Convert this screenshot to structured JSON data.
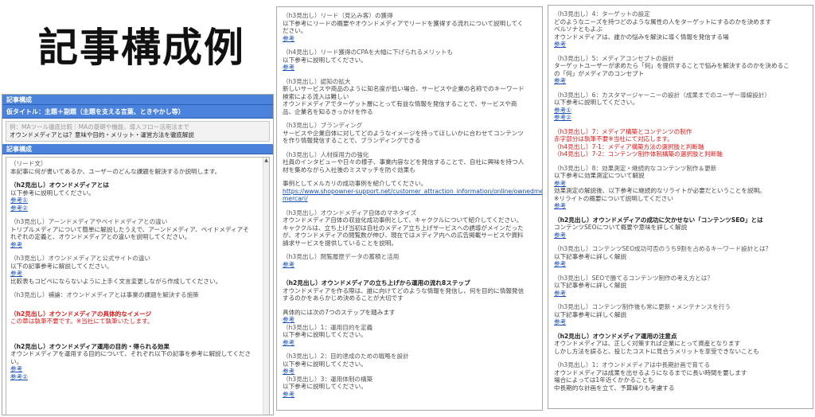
{
  "page_title": "記事構成例",
  "left": {
    "section1_bar": "記事構成",
    "title_bar": "仮タイトル：主題＋副題（主題を支える言葉、ときやかし等）",
    "title_field_placeholder": "例：MAツール徹底比較｜MAの基礎や機能、導入フロー活用法まで",
    "title_field_value": "オウンドメディアとは？意味や目的・メリット・運営方法を徹底解説",
    "section2_bar": "記事構成",
    "lines": [
      {
        "t": "（リード文）",
        "c": "h"
      },
      {
        "t": "本記事に何が書いてあるか、ユーザーのどんな課題を解決するか説明します。",
        "c": "n"
      },
      {
        "t": "",
        "c": "gap"
      },
      {
        "t": "（h2見出し）オウンドメディアとは",
        "c": "b"
      },
      {
        "t": "以下参考に説明してください。",
        "c": "n"
      },
      {
        "t": "参考①",
        "c": "link"
      },
      {
        "t": "参考②",
        "c": "link"
      },
      {
        "t": "",
        "c": "gap"
      },
      {
        "t": "（h3見出し）アーンドメディアやペイドメディアとの違い",
        "c": "h"
      },
      {
        "t": "トリプルメディアについて簡単に解説したうえで、アーンドメディア、ペイドメディアそ",
        "c": "n"
      },
      {
        "t": "れぞれの定義と、オウンドメディアとの違いを説明してください。",
        "c": "n"
      },
      {
        "t": "参考",
        "c": "link"
      },
      {
        "t": "",
        "c": "gap"
      },
      {
        "t": "（h3見出し）オウンドメディアと公式サイトの違い",
        "c": "h"
      },
      {
        "t": "以下の記事参考に解説してください。",
        "c": "n"
      },
      {
        "t": "参考",
        "c": "link"
      },
      {
        "t": "比較表もコピペにならないように上手く文言変更しながら作成してください。",
        "c": "n"
      },
      {
        "t": "",
        "c": "gap"
      },
      {
        "t": "（h3見出し）補論：オウンドメディアとは事業の課題を解決する施策",
        "c": "h"
      },
      {
        "t": "",
        "c": "gap2"
      },
      {
        "t": "（h2見出し）オウンドメディアの具体的なイメージ",
        "c": "redb"
      },
      {
        "t": "この章は執筆不要です。※当社にて執筆いたします。",
        "c": "red"
      },
      {
        "t": "",
        "c": "gap2"
      },
      {
        "t": "",
        "c": "gap"
      },
      {
        "t": "（h2見出し）オウンドメディア運用の目的・得られる効果",
        "c": "b"
      },
      {
        "t": "オウンドメディアを運用する目的について、それぞれ以下の記事を参考に解説してくださ",
        "c": "n"
      },
      {
        "t": "い。",
        "c": "n"
      },
      {
        "t": "参考",
        "c": "link"
      },
      {
        "t": "参考②",
        "c": "link"
      }
    ]
  },
  "middle": {
    "lines": [
      {
        "t": "（h3見出し）リード（見込み客）の獲得",
        "c": "h"
      },
      {
        "t": "以下参考にリードの概要やオウンドメディアでリードを獲得する流れについて説明してく",
        "c": "n"
      },
      {
        "t": "ださい。",
        "c": "n"
      },
      {
        "t": "参考",
        "c": "link"
      },
      {
        "t": "",
        "c": "gap"
      },
      {
        "t": "（h4見出し）リード獲得のCPAを大幅に下げられるメリットも",
        "c": "h"
      },
      {
        "t": "以下参考に説明してください。",
        "c": "n"
      },
      {
        "t": "参考",
        "c": "link"
      },
      {
        "t": "",
        "c": "gap"
      },
      {
        "t": "（h3見出し）認知の拡大",
        "c": "h"
      },
      {
        "t": "新しいサービスや商品のように知名度が低い場合、サービスや企業の名称でのキーワード",
        "c": "n"
      },
      {
        "t": "検索による流入は難しい",
        "c": "n"
      },
      {
        "t": "オウンドメディアでターゲット層にとって有益な情報を発信することで、サービスや商",
        "c": "n"
      },
      {
        "t": "品、企業名を知るきっかけを作る",
        "c": "n"
      },
      {
        "t": "",
        "c": "gap"
      },
      {
        "t": "（h3見出し）ブランディング",
        "c": "h"
      },
      {
        "t": "サービスや企業自体に対してどのようなイメージを持ってほしいかに合わせてコンテンツ",
        "c": "n"
      },
      {
        "t": "を作り情報発信することで、ブランディングできる",
        "c": "n"
      },
      {
        "t": "",
        "c": "gap"
      },
      {
        "t": "（h3見出し）人材採用力の強化",
        "c": "h"
      },
      {
        "t": "社員のインタビューや日々の様子、事業内容などを発信することで、自社に興味を持つ人",
        "c": "n"
      },
      {
        "t": "材を集めながら入社後のミスマッチを防ぐ効果も",
        "c": "n"
      },
      {
        "t": "",
        "c": "gap"
      },
      {
        "t": "事例としてメルカリの成功事例を紹介してください。",
        "c": "n"
      },
      {
        "t": "https://www.shopowner-support.net/customer_attraction_information/online/ownedmedia/",
        "c": "link"
      },
      {
        "t": "mercari/",
        "c": "link"
      },
      {
        "t": "",
        "c": "gap"
      },
      {
        "t": "（h3見出し）オウンドメディア自体のマネタイズ",
        "c": "h"
      },
      {
        "t": "オウンドメディア自体の収益化成功事例として、キャククルについて紹介してください。",
        "c": "n"
      },
      {
        "t": "キャククルは、立ち上げ当初は自社のメディア立ち上げサービスへの誘導がメインだった",
        "c": "n"
      },
      {
        "t": "が、オウンドメディアの閲覧数が伸び、現在ではメディア内への広告掲載サービスや資料",
        "c": "n"
      },
      {
        "t": "請求サービスを提供していることを説明。",
        "c": "n"
      },
      {
        "t": "",
        "c": "gap"
      },
      {
        "t": "（h3見出し）閲覧履歴データの蓄積と活用",
        "c": "h"
      },
      {
        "t": "参考",
        "c": "link"
      },
      {
        "t": "",
        "c": "gap2"
      },
      {
        "t": "（h2見出し）オウンドメディアの立ち上げから運用の流れ8ステップ",
        "c": "b"
      },
      {
        "t": "オウンドメディアを作る際は、誰に向けてどのような情報を発信し、何を目的に情報発信",
        "c": "n"
      },
      {
        "t": "するのかをあらかじめ決めることが大切です",
        "c": "n"
      },
      {
        "t": "",
        "c": "gap"
      },
      {
        "t": "具体的には次の7つのステップを踏みます",
        "c": "n"
      },
      {
        "t": "参考",
        "c": "link"
      },
      {
        "t": "（h3見出し）1：運用目的を定義",
        "c": "h"
      },
      {
        "t": "以下参考に説明してください。",
        "c": "n"
      },
      {
        "t": "参考",
        "c": "link"
      },
      {
        "t": "",
        "c": "gap"
      },
      {
        "t": "（h3見出し）2：目的達成のための戦略を設計",
        "c": "h"
      },
      {
        "t": "以下参考に説明してください。",
        "c": "n"
      },
      {
        "t": "参考",
        "c": "link"
      },
      {
        "t": "（h3見出し）3：運用体制の構築",
        "c": "h"
      },
      {
        "t": "以下参考に説明してください。",
        "c": "n"
      },
      {
        "t": "参考",
        "c": "link"
      }
    ]
  },
  "right": {
    "lines": [
      {
        "t": "（h3見出し）4：ターゲットの設定",
        "c": "h"
      },
      {
        "t": "どのようなニーズを持つどのような属性の人をターゲットにするのかを決めます",
        "c": "n"
      },
      {
        "t": "ペルソナともよぶ",
        "c": "n"
      },
      {
        "t": "オウンドメディアは、誰かの悩みを解決に導く情報を発信する場",
        "c": "n"
      },
      {
        "t": "参考",
        "c": "link"
      },
      {
        "t": "",
        "c": "gap"
      },
      {
        "t": "（h3見出し）5：メディアコンセプトの設計",
        "c": "h"
      },
      {
        "t": "ターゲットユーザーが求めたら「何」を提供することで悩みを解決するのかを決めるこ",
        "c": "n"
      },
      {
        "t": "の「何」がメディアのコンセプト",
        "c": "n"
      },
      {
        "t": "参考",
        "c": "link"
      },
      {
        "t": "",
        "c": "gap"
      },
      {
        "t": "（h3見出し）6：カスタマージャーニーの設計（成果までのユーザー導線設計）",
        "c": "h"
      },
      {
        "t": "以下参考に説明してください。",
        "c": "n"
      },
      {
        "t": "参考①",
        "c": "link"
      },
      {
        "t": "参考②",
        "c": "link"
      },
      {
        "t": "",
        "c": "gap"
      },
      {
        "t": "（h3見出し）7：メディア構築とコンテンツの制作",
        "c": "red"
      },
      {
        "t": "赤字部分は執筆不要※当社にて対応します。",
        "c": "red"
      },
      {
        "t": "（h4見出し）7-1：メディア構築方法の選択肢と判断軸",
        "c": "red"
      },
      {
        "t": "（h4見出し）7-2：コンテンツ制作体制構築の選択肢と判断軸",
        "c": "red"
      },
      {
        "t": "",
        "c": "gap"
      },
      {
        "t": "（h3見出し）8：効果測定・継続的なコンテンツ制作＆更新",
        "c": "h"
      },
      {
        "t": "以下参考に効果測定について解説",
        "c": "n"
      },
      {
        "t": "参考",
        "c": "link"
      },
      {
        "t": "効果測定の解説後、以下参考に継続的なリライトが必要だということを説明。",
        "c": "n"
      },
      {
        "t": "※リライトの概要について説明してください",
        "c": "n"
      },
      {
        "t": "参考",
        "c": "link"
      },
      {
        "t": "",
        "c": "gap"
      },
      {
        "t": "（h2見出し）オウンドメディアの成功に欠かせない「コンテンツSEO」とは",
        "c": "b"
      },
      {
        "t": "コンテンツSEOについて概要や意味を詳しく解説",
        "c": "n"
      },
      {
        "t": "参考",
        "c": "link"
      },
      {
        "t": "",
        "c": "gap"
      },
      {
        "t": "（h3見出し）コンテンツSEO成功可否のうち9割を占めるキーワード設計とは？",
        "c": "h"
      },
      {
        "t": "以下記事参考に詳しく解説",
        "c": "n"
      },
      {
        "t": "参考",
        "c": "link"
      },
      {
        "t": "",
        "c": "gap"
      },
      {
        "t": "（h3見出し）SEOで勝てるコンテンツ制作の考え方とは？",
        "c": "h"
      },
      {
        "t": "以下記事参考に詳しく解説",
        "c": "n"
      },
      {
        "t": "参考",
        "c": "link"
      },
      {
        "t": "",
        "c": "gap"
      },
      {
        "t": "（h3見出し）コンテンツ制作後も常に更新・メンテナンスを行う",
        "c": "h"
      },
      {
        "t": "以下記事参考に詳しく解説",
        "c": "n"
      },
      {
        "t": "参考",
        "c": "link"
      },
      {
        "t": "",
        "c": "gap"
      },
      {
        "t": "（h2見出し）オウンドメディア運用の注意点",
        "c": "b"
      },
      {
        "t": "オウンドメディアは、正しく対策すれば企業にとって資産となります",
        "c": "n"
      },
      {
        "t": "しかし方法を誤ると、投じたコストに見合うメリットを享受できないことも",
        "c": "n"
      },
      {
        "t": "",
        "c": "gap"
      },
      {
        "t": "（h3見出し）1：オウンドメディアは中長期計画で育てる",
        "c": "h"
      },
      {
        "t": "オウンドメディアは成果を出せるようになるまでに長い時間を要します",
        "c": "n"
      },
      {
        "t": "場合によっては1年近くかかることも",
        "c": "n"
      },
      {
        "t": "中長期的な計画を立て、予算繰りも考慮する",
        "c": "n"
      }
    ]
  }
}
